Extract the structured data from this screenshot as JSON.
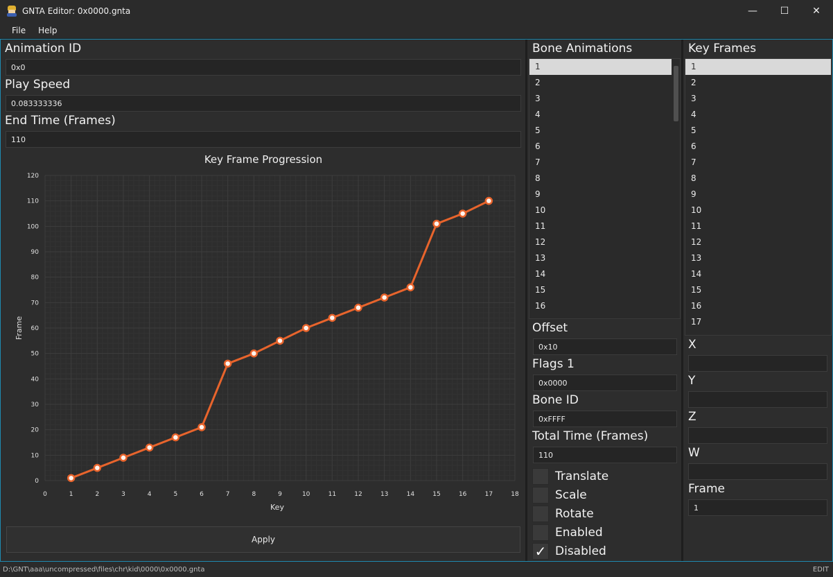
{
  "window": {
    "title": "GNTA Editor: 0x0000.gnta",
    "minimize": "—",
    "maximize": "☐",
    "close": "✕"
  },
  "menu": {
    "file": "File",
    "help": "Help"
  },
  "left": {
    "animation_id_label": "Animation ID",
    "animation_id_value": "0x0",
    "play_speed_label": "Play Speed",
    "play_speed_value": "0.083333336",
    "end_time_label": "End Time (Frames)",
    "end_time_value": "110",
    "apply_label": "Apply"
  },
  "chart_data": {
    "type": "line",
    "title": "Key Frame Progression",
    "xlabel": "Key",
    "ylabel": "Frame",
    "xlim": [
      0,
      18
    ],
    "ylim": [
      0,
      120
    ],
    "xticks": [
      0,
      1,
      2,
      3,
      4,
      5,
      6,
      7,
      8,
      9,
      10,
      11,
      12,
      13,
      14,
      15,
      16,
      17,
      18
    ],
    "yticks": [
      0,
      10,
      20,
      30,
      40,
      50,
      60,
      70,
      80,
      90,
      100,
      110,
      120
    ],
    "grid": true,
    "color": "#e8642c",
    "x": [
      1,
      2,
      3,
      4,
      5,
      6,
      7,
      8,
      9,
      10,
      11,
      12,
      13,
      14,
      15,
      16,
      17
    ],
    "y": [
      1,
      5,
      9,
      13,
      17,
      21,
      46,
      50,
      55,
      60,
      64,
      68,
      72,
      76,
      101,
      105,
      110
    ]
  },
  "bone_animations": {
    "label": "Bone Animations",
    "items": [
      "1",
      "2",
      "3",
      "4",
      "5",
      "6",
      "7",
      "8",
      "9",
      "10",
      "11",
      "12",
      "13",
      "14",
      "15",
      "16"
    ],
    "selected_index": 0,
    "offset_label": "Offset",
    "offset_value": "0x10",
    "flags_label": "Flags 1",
    "flags_value": "0x0000",
    "bone_id_label": "Bone ID",
    "bone_id_value": "0xFFFF",
    "total_time_label": "Total Time (Frames)",
    "total_time_value": "110",
    "checks": [
      {
        "label": "Translate",
        "checked": false
      },
      {
        "label": "Scale",
        "checked": false
      },
      {
        "label": "Rotate",
        "checked": false
      },
      {
        "label": "Enabled",
        "checked": false
      },
      {
        "label": "Disabled",
        "checked": true
      }
    ],
    "check_mark": "✓"
  },
  "key_frames": {
    "label": "Key Frames",
    "items": [
      "1",
      "2",
      "3",
      "4",
      "5",
      "6",
      "7",
      "8",
      "9",
      "10",
      "11",
      "12",
      "13",
      "14",
      "15",
      "16",
      "17"
    ],
    "selected_index": 0,
    "x_label": "X",
    "x_value": "",
    "y_label": "Y",
    "y_value": "",
    "z_label": "Z",
    "z_value": "",
    "w_label": "W",
    "w_value": "",
    "frame_label": "Frame",
    "frame_value": "1"
  },
  "status": {
    "path": "D:\\GNT\\aaa\\uncompressed\\files\\chr\\kid\\0000\\0x0000.gnta",
    "mode": "EDIT"
  }
}
